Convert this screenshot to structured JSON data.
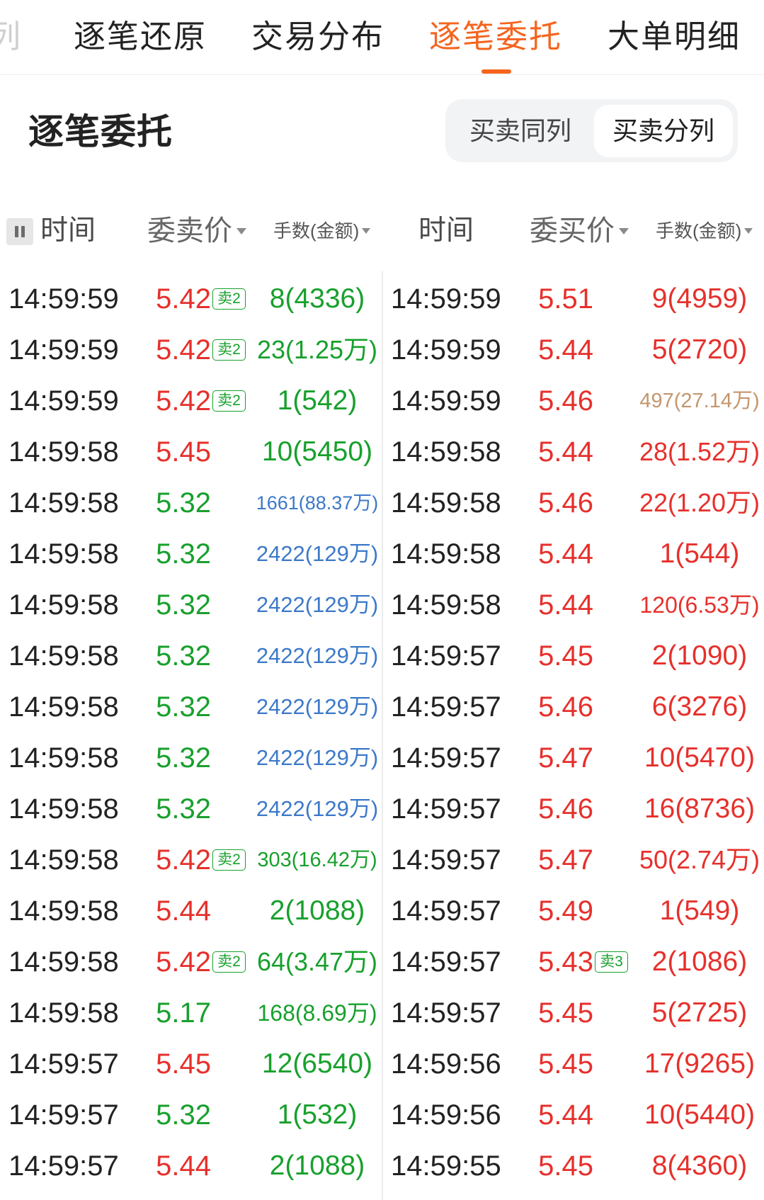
{
  "tabs": [
    {
      "label": "列"
    },
    {
      "label": "逐笔还原"
    },
    {
      "label": "交易分布"
    },
    {
      "label": "逐笔委托",
      "active": true
    },
    {
      "label": "大单明细"
    }
  ],
  "section_title": "逐笔委托",
  "view_toggle": {
    "options": [
      {
        "label": "买卖同列"
      },
      {
        "label": "买卖分列",
        "selected": true
      }
    ]
  },
  "icons": {
    "pause": "pause-icon",
    "sort": "caret-down-icon"
  },
  "colors": {
    "accent": "#f5641e",
    "red": "#e6302c",
    "green": "#18a02d",
    "blue": "#3c79c9",
    "tan": "#c4966c",
    "badge": "#18a02d",
    "text": "#222222"
  },
  "sell_table": {
    "headers": {
      "time": "时间",
      "price": "委卖价",
      "volume": "手数(金额)"
    },
    "rows": [
      {
        "time": "14:59:59",
        "price": "5.42",
        "price_color": "#e6302c",
        "badge": "卖2",
        "volume": "8(4336)",
        "volume_color": "#18a02d"
      },
      {
        "time": "14:59:59",
        "price": "5.42",
        "price_color": "#e6302c",
        "badge": "卖2",
        "volume": "23(1.25万)",
        "volume_color": "#18a02d"
      },
      {
        "time": "14:59:59",
        "price": "5.42",
        "price_color": "#e6302c",
        "badge": "卖2",
        "volume": "1(542)",
        "volume_color": "#18a02d"
      },
      {
        "time": "14:59:58",
        "price": "5.45",
        "price_color": "#e6302c",
        "volume": "10(5450)",
        "volume_color": "#18a02d"
      },
      {
        "time": "14:59:58",
        "price": "5.32",
        "price_color": "#18a02d",
        "volume": "1661(88.37万)",
        "volume_color": "#3c79c9"
      },
      {
        "time": "14:59:58",
        "price": "5.32",
        "price_color": "#18a02d",
        "volume": "2422(129万)",
        "volume_color": "#3c79c9"
      },
      {
        "time": "14:59:58",
        "price": "5.32",
        "price_color": "#18a02d",
        "volume": "2422(129万)",
        "volume_color": "#3c79c9"
      },
      {
        "time": "14:59:58",
        "price": "5.32",
        "price_color": "#18a02d",
        "volume": "2422(129万)",
        "volume_color": "#3c79c9"
      },
      {
        "time": "14:59:58",
        "price": "5.32",
        "price_color": "#18a02d",
        "volume": "2422(129万)",
        "volume_color": "#3c79c9"
      },
      {
        "time": "14:59:58",
        "price": "5.32",
        "price_color": "#18a02d",
        "volume": "2422(129万)",
        "volume_color": "#3c79c9"
      },
      {
        "time": "14:59:58",
        "price": "5.32",
        "price_color": "#18a02d",
        "volume": "2422(129万)",
        "volume_color": "#3c79c9"
      },
      {
        "time": "14:59:58",
        "price": "5.42",
        "price_color": "#e6302c",
        "badge": "卖2",
        "volume": "303(16.42万)",
        "volume_color": "#18a02d"
      },
      {
        "time": "14:59:58",
        "price": "5.44",
        "price_color": "#e6302c",
        "volume": "2(1088)",
        "volume_color": "#18a02d"
      },
      {
        "time": "14:59:58",
        "price": "5.42",
        "price_color": "#e6302c",
        "badge": "卖2",
        "volume": "64(3.47万)",
        "volume_color": "#18a02d"
      },
      {
        "time": "14:59:58",
        "price": "5.17",
        "price_color": "#18a02d",
        "volume": "168(8.69万)",
        "volume_color": "#18a02d"
      },
      {
        "time": "14:59:57",
        "price": "5.45",
        "price_color": "#e6302c",
        "volume": "12(6540)",
        "volume_color": "#18a02d"
      },
      {
        "time": "14:59:57",
        "price": "5.32",
        "price_color": "#18a02d",
        "volume": "1(532)",
        "volume_color": "#18a02d"
      },
      {
        "time": "14:59:57",
        "price": "5.44",
        "price_color": "#e6302c",
        "volume": "2(1088)",
        "volume_color": "#18a02d"
      }
    ]
  },
  "buy_table": {
    "headers": {
      "time": "时间",
      "price": "委买价",
      "volume": "手数(金额)"
    },
    "rows": [
      {
        "time": "14:59:59",
        "price": "5.51",
        "price_color": "#e6302c",
        "volume": "9(4959)",
        "volume_color": "#e6302c"
      },
      {
        "time": "14:59:59",
        "price": "5.44",
        "price_color": "#e6302c",
        "volume": "5(2720)",
        "volume_color": "#e6302c"
      },
      {
        "time": "14:59:59",
        "price": "5.46",
        "price_color": "#e6302c",
        "volume": "497(27.14万)",
        "volume_color": "#c4966c"
      },
      {
        "time": "14:59:58",
        "price": "5.44",
        "price_color": "#e6302c",
        "volume": "28(1.52万)",
        "volume_color": "#e6302c"
      },
      {
        "time": "14:59:58",
        "price": "5.46",
        "price_color": "#e6302c",
        "volume": "22(1.20万)",
        "volume_color": "#e6302c"
      },
      {
        "time": "14:59:58",
        "price": "5.44",
        "price_color": "#e6302c",
        "volume": "1(544)",
        "volume_color": "#e6302c"
      },
      {
        "time": "14:59:58",
        "price": "5.44",
        "price_color": "#e6302c",
        "volume": "120(6.53万)",
        "volume_color": "#e6302c"
      },
      {
        "time": "14:59:57",
        "price": "5.45",
        "price_color": "#e6302c",
        "volume": "2(1090)",
        "volume_color": "#e6302c"
      },
      {
        "time": "14:59:57",
        "price": "5.46",
        "price_color": "#e6302c",
        "volume": "6(3276)",
        "volume_color": "#e6302c"
      },
      {
        "time": "14:59:57",
        "price": "5.47",
        "price_color": "#e6302c",
        "volume": "10(5470)",
        "volume_color": "#e6302c"
      },
      {
        "time": "14:59:57",
        "price": "5.46",
        "price_color": "#e6302c",
        "volume": "16(8736)",
        "volume_color": "#e6302c"
      },
      {
        "time": "14:59:57",
        "price": "5.47",
        "price_color": "#e6302c",
        "volume": "50(2.74万)",
        "volume_color": "#e6302c"
      },
      {
        "time": "14:59:57",
        "price": "5.49",
        "price_color": "#e6302c",
        "volume": "1(549)",
        "volume_color": "#e6302c"
      },
      {
        "time": "14:59:57",
        "price": "5.43",
        "price_color": "#e6302c",
        "badge": "卖3",
        "volume": "2(1086)",
        "volume_color": "#e6302c"
      },
      {
        "time": "14:59:57",
        "price": "5.45",
        "price_color": "#e6302c",
        "volume": "5(2725)",
        "volume_color": "#e6302c"
      },
      {
        "time": "14:59:56",
        "price": "5.45",
        "price_color": "#e6302c",
        "volume": "17(9265)",
        "volume_color": "#e6302c"
      },
      {
        "time": "14:59:56",
        "price": "5.44",
        "price_color": "#e6302c",
        "volume": "10(5440)",
        "volume_color": "#e6302c"
      },
      {
        "time": "14:59:55",
        "price": "5.45",
        "price_color": "#e6302c",
        "volume": "8(4360)",
        "volume_color": "#e6302c"
      }
    ]
  }
}
